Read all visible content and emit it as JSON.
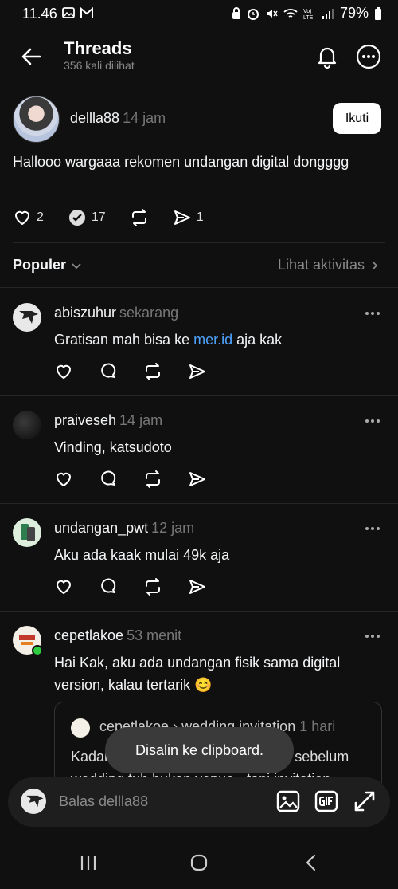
{
  "status": {
    "time": "11.46",
    "battery": "79%"
  },
  "header": {
    "title": "Threads",
    "subtitle": "356 kali dilihat"
  },
  "post": {
    "username": "dellla88",
    "time": "14 jam",
    "follow_label": "Ikuti",
    "text": "Hallooo wargaaa rekomen undangan digital dongggg",
    "likes": "2",
    "comments": "17",
    "shares": "1"
  },
  "filter": {
    "label": "Populer",
    "activity": "Lihat aktivitas"
  },
  "comments": [
    {
      "username": "abiszuhur",
      "time": "sekarang",
      "text_before": "Gratisan mah bisa ke ",
      "link": "mer.id",
      "text_after": " aja kak"
    },
    {
      "username": "praiveseh",
      "time": "14 jam",
      "text": "Vinding, katsudoto"
    },
    {
      "username": "undangan_pwt",
      "time": "12 jam",
      "text": "Aku ada kaak mulai 49k aja"
    },
    {
      "username": "cepetlakoe",
      "time": "53 menit",
      "text": "Hai Kak, aku ada undangan fisik sama digital version, kalau tertarik 😊"
    }
  ],
  "quote": {
    "username": "cepetlakoe",
    "sep": "›",
    "topic": "wedding invitation",
    "time": "1 hari",
    "text": "Kadang yang paling sering posting sebelum wedding tuh bukan venue - tapi invitation"
  },
  "toast": {
    "text": "Disalin ke clipboard."
  },
  "reply": {
    "placeholder": "Balas dellla88"
  }
}
